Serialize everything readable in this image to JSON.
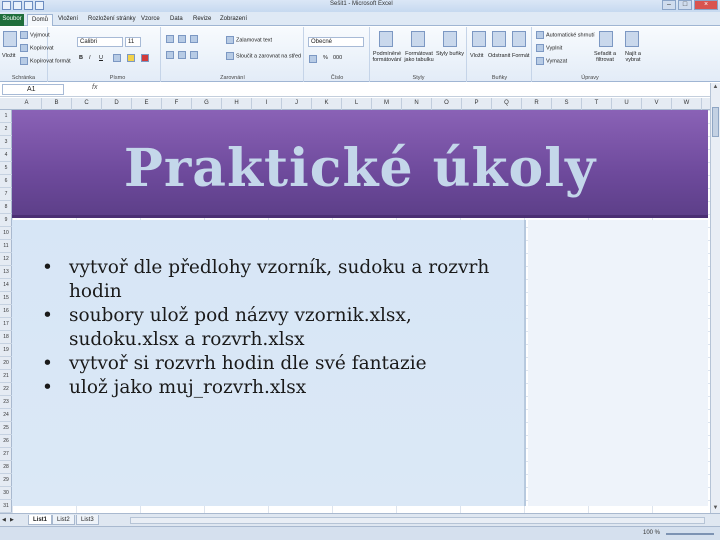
{
  "titlebar": {
    "document_title": "Sešit1 - Microsoft Excel"
  },
  "ribbon": {
    "tabs": [
      "Soubor",
      "Domů",
      "Vložení",
      "Rozložení stránky",
      "Vzorce",
      "Data",
      "Revize",
      "Zobrazení"
    ],
    "groups": [
      "Schránka",
      "Písmo",
      "Zarovnání",
      "Číslo",
      "Styly",
      "Buňky",
      "Úpravy"
    ],
    "clipboard": {
      "paste": "Vložit",
      "cut": "Vyjmout",
      "copy": "Kopírovat",
      "format_painter": "Kopírovat formát"
    },
    "font": {
      "name": "Calibri",
      "size": "11",
      "bold": "B",
      "italic": "I",
      "underline": "U"
    },
    "alignment": {
      "wrap": "Zalamovat text",
      "merge": "Sloučit a zarovnat na střed"
    },
    "number": {
      "format": "Obecné",
      "percent": "%",
      "thousands": "000"
    },
    "styles": {
      "conditional": "Podmíněné formátování",
      "as_table": "Formátovat jako tabulku",
      "cell_styles": "Styly buňky"
    },
    "cells": {
      "insert": "Vložit",
      "delete": "Odstranit",
      "format": "Formát"
    },
    "editing": {
      "autosum": "Automatické shrnutí",
      "fill": "Vyplnit",
      "clear": "Vymazat",
      "sort": "Seřadit a filtrovat",
      "find": "Najít a vybrat"
    }
  },
  "formula_bar": {
    "name_box": "A1",
    "fx": "fx",
    "content": ""
  },
  "columns": [
    "A",
    "B",
    "C",
    "D",
    "E",
    "F",
    "G",
    "H",
    "I",
    "J",
    "K",
    "L",
    "M",
    "N",
    "O",
    "P",
    "Q",
    "R",
    "S",
    "T",
    "U",
    "V",
    "W"
  ],
  "rows": [
    "1",
    "2",
    "3",
    "4",
    "5",
    "6",
    "7",
    "8",
    "9",
    "10",
    "11",
    "12",
    "13",
    "14",
    "15",
    "16",
    "17",
    "18",
    "19",
    "20",
    "21",
    "22",
    "23",
    "24",
    "25",
    "26",
    "27",
    "28",
    "29",
    "30",
    "31"
  ],
  "slide": {
    "title": "Praktické úkoly",
    "bullets": [
      "vytvoř dle předlohy vzorník, sudoku a rozvrh hodin",
      "soubory ulož pod názvy vzornik.xlsx, sudoku.xlsx a rozvrh.xlsx",
      "vytvoř si rozvrh hodin dle své fantazie",
      "ulož jako muj_rozvrh.xlsx"
    ],
    "bullet_char": "•"
  },
  "sheets": [
    "List1",
    "List2",
    "List3"
  ],
  "status": {
    "zoom": "100 %"
  },
  "colors": {
    "title_band": "#6e4a9c",
    "title_text": "#c4d7ea",
    "body_bg": "#d7e6f6",
    "file_tab": "#1f6e3c"
  }
}
